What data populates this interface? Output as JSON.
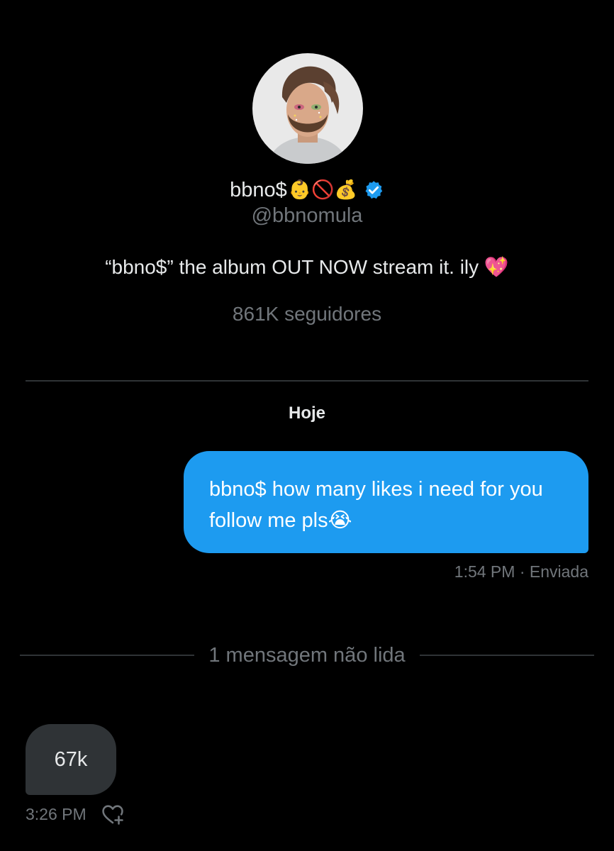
{
  "profile": {
    "display_name": "bbno$",
    "name_emojis": "👶🚫💰",
    "handle": "@bbnomula",
    "bio": "“bbno$” the album OUT NOW stream it. ily 💖",
    "followers": "861K seguidores",
    "verified_color": "#1d9bf0"
  },
  "conversation": {
    "date_label": "Hoje",
    "sent_message": {
      "text": "bbno$ how many likes i need for you follow me pls😭",
      "meta": "1:54 PM · Enviada",
      "bubble_color": "#1d9bf0"
    },
    "unread_label": "1 mensagem não lida",
    "received_message": {
      "text": "67k",
      "time": "3:26 PM",
      "bubble_color": "#2f3336",
      "reaction_icon": "heart-add-icon"
    }
  },
  "colors": {
    "background": "#000000",
    "primary_text": "#e7e9ea",
    "secondary_text": "#71767b",
    "divider": "#2f3336"
  }
}
